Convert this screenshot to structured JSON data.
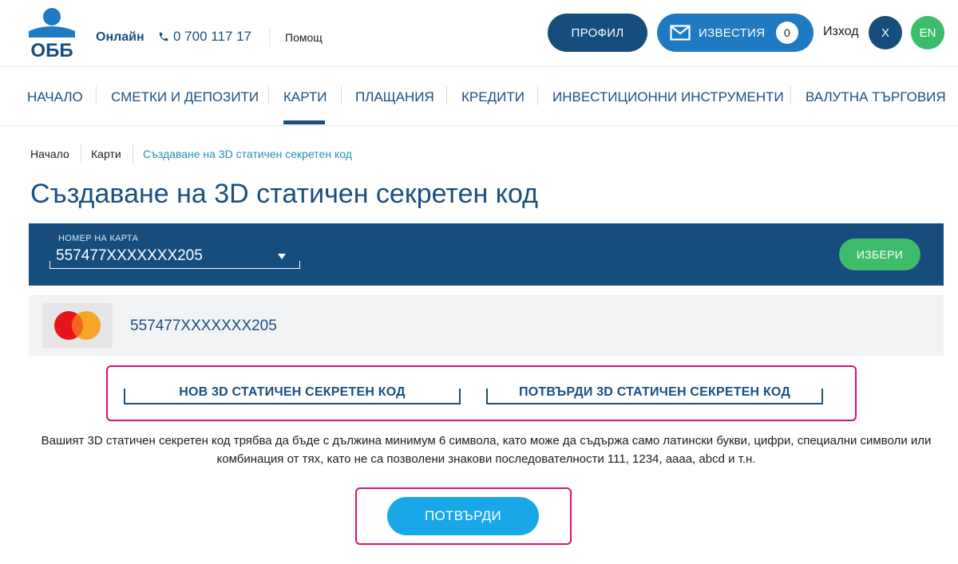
{
  "header": {
    "logo_text": "ОББ",
    "brand_sub": "Онлайн",
    "phone": "0 700 117 17",
    "help": "Помощ",
    "profile_label": "ПРОФИЛ",
    "notifications_label": "ИЗВЕСТИЯ",
    "notifications_count": "0",
    "logout_label": "Изход",
    "user_initial": "X",
    "language": "EN"
  },
  "nav": {
    "items": [
      {
        "label": "НАЧАЛО",
        "active": false
      },
      {
        "label": "СМЕТКИ И ДЕПОЗИТИ",
        "active": false
      },
      {
        "label": "КАРТИ",
        "active": true
      },
      {
        "label": "ПЛАЩАНИЯ",
        "active": false
      },
      {
        "label": "КРЕДИТИ",
        "active": false
      },
      {
        "label": "ИНВЕСТИЦИОННИ ИНСТРУМЕНТИ",
        "active": false
      },
      {
        "label": "ВАЛУТНА ТЪРГОВИЯ",
        "active": false
      }
    ]
  },
  "breadcrumb": [
    "Начало",
    "Карти",
    "Създаване на 3D статичен секретен код"
  ],
  "page_title": "Създаване на 3D статичен секретен код",
  "card_selector": {
    "label": "НОМЕР НА КАРТА",
    "value": "557477XXXXXXX205",
    "select_button": "ИЗБЕРИ"
  },
  "card_row": {
    "brand_icon": "mastercard-icon",
    "number": "557477XXXXXXX205"
  },
  "fields": {
    "new_code_label": "НОВ 3D СТАТИЧЕН СЕКРЕТЕН КОД",
    "confirm_code_label": "ПОТВЪРДИ 3D СТАТИЧЕН СЕКРЕТЕН КОД"
  },
  "hint": "Вашият 3D статичен секретен код трябва да бъде с дължина минимум 6 символа, като може да съдържа само латински букви, цифри, специални символи или комбинация от тях, като не са позволени знакови последователности 111, 1234, аааа, abcd и т.н.",
  "confirm_button": "ПОТВЪРДИ",
  "colors": {
    "brand_blue": "#174d7d",
    "accent_blue": "#1f7ac2",
    "confirm_blue": "#18a8e8",
    "green": "#3dbd6b",
    "highlight_magenta": "#d4127a"
  }
}
